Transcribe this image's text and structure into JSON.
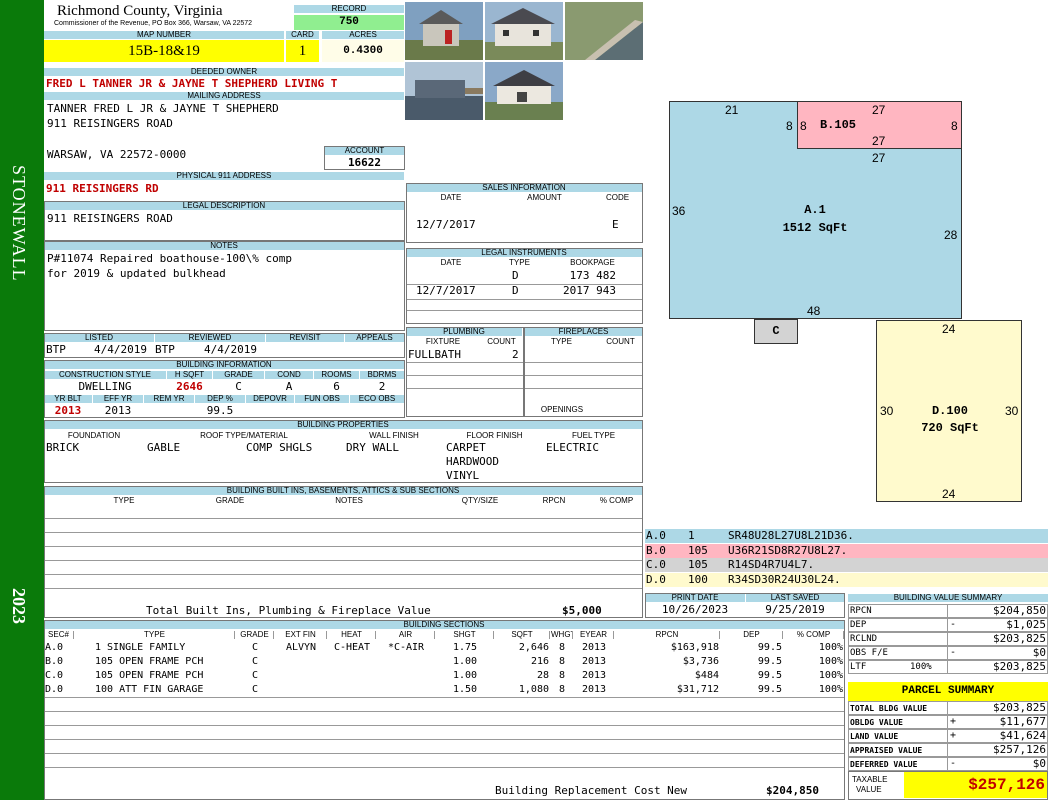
{
  "district": "STONEWALL",
  "year": "2023",
  "header": {
    "county": "Richmond County, Virginia",
    "commissioner": "Commissioner of the Revenue, PO Box 366, Warsaw, VA 22572",
    "record_label": "RECORD",
    "record": "750",
    "map_label": "MAP NUMBER",
    "map_number": "15B-18&19",
    "card_label": "CARD",
    "card": "1",
    "acres_label": "ACRES",
    "acres": "0.4300"
  },
  "owner": {
    "label": "DEEDED OWNER",
    "name": "FRED L TANNER JR & JAYNE T SHEPHERD LIVING T",
    "mail_label": "MAILING ADDRESS",
    "mail1": "TANNER FRED L JR & JAYNE T SHEPHERD",
    "mail2": "911 REISINGERS ROAD",
    "mail3": "WARSAW, VA 22572-0000",
    "account_label": "ACCOUNT",
    "account": "16622"
  },
  "phys": {
    "label": "PHYSICAL 911 ADDRESS",
    "value": "911 REISINGERS RD"
  },
  "legal": {
    "label": "LEGAL DESCRIPTION",
    "value": "911 REISINGERS ROAD"
  },
  "notes": {
    "label": "NOTES",
    "line1": "P#11074 Repaired boathouse-100\\% comp",
    "line2": "for 2019 & updated bulkhead"
  },
  "listing": {
    "listed_label": "LISTED",
    "reviewed_label": "REVIEWED",
    "revisit_label": "REVISIT",
    "appeals_label": "APPEALS",
    "listed_by": "BTP",
    "listed_date": "4/4/2019",
    "reviewed_by": "BTP",
    "reviewed_date": "4/4/2019"
  },
  "building_info": {
    "label": "BUILDING INFORMATION",
    "h_cs": "CONSTRUCTION STYLE",
    "h_hsqft": "H SQFT",
    "h_grade": "GRADE",
    "h_cond": "COND",
    "h_rooms": "ROOMS",
    "h_bdrms": "BDRMS",
    "style": "DWELLING",
    "hsqft": "2646",
    "grade": "C",
    "cond": "A",
    "rooms": "6",
    "bdrms": "2",
    "h_yrblt": "YR BLT",
    "h_effyr": "EFF YR",
    "h_remyr": "REM YR",
    "h_dep": "DEP %",
    "h_depovr": "DEPOVR",
    "h_funobs": "FUN OBS",
    "h_ecoobs": "ECO OBS",
    "yrblt": "2013",
    "effyr": "2013",
    "dep": "99.5"
  },
  "sales": {
    "label": "SALES INFORMATION",
    "h_date": "DATE",
    "h_amount": "AMOUNT",
    "h_code": "CODE",
    "date": "12/7/2017",
    "code": "E"
  },
  "instruments": {
    "label": "LEGAL INSTRUMENTS",
    "h_date": "DATE",
    "h_type": "TYPE",
    "h_bookpage": "BOOKPAGE",
    "rows": [
      {
        "date": "",
        "type": "D",
        "bookpage": "173 482"
      },
      {
        "date": "12/7/2017",
        "type": "D",
        "bookpage": "2017 943"
      }
    ]
  },
  "plumbing": {
    "label": "PLUMBING",
    "h_fixture": "FIXTURE",
    "h_count": "COUNT",
    "fixture": "FULLBATH",
    "count": "2"
  },
  "fireplaces": {
    "label": "FIREPLACES",
    "h_type": "TYPE",
    "h_count": "COUNT",
    "openings": "OPENINGS"
  },
  "props": {
    "label": "BUILDING PROPERTIES",
    "h_foundation": "FOUNDATION",
    "h_roof": "ROOF TYPE/MATERIAL",
    "h_wall": "WALL FINISH",
    "h_floor": "FLOOR FINISH",
    "h_fuel": "FUEL TYPE",
    "foundation": "BRICK",
    "roof_type": "GABLE",
    "roof_mat": "COMP SHGLS",
    "wall": "DRY WALL",
    "floor1": "CARPET",
    "floor2": "HARDWOOD",
    "floor3": "VINYL",
    "fuel": "ELECTRIC"
  },
  "builtins": {
    "label": "BUILDING BUILT INS, BASEMENTS, ATTICS & SUB SECTIONS",
    "h_type": "TYPE",
    "h_grade": "GRADE",
    "h_notes": "NOTES",
    "h_qty": "QTY/SIZE",
    "h_rpcn": "RPCN",
    "h_comp": "% COMP",
    "total_label": "Total Built Ins, Plumbing & Fireplace Value",
    "total": "$5,000"
  },
  "print": {
    "print_label": "PRINT DATE",
    "saved_label": "LAST SAVED",
    "print_date": "10/26/2023",
    "last_saved": "9/25/2019"
  },
  "sections": {
    "label": "BUILDING SECTIONS",
    "headers": [
      "SEC#",
      "TYPE",
      "GRADE",
      "EXT FIN",
      "HEAT",
      "AIR",
      "SHGT",
      "SQFT",
      "WHGT",
      "EYEAR",
      "RPCN",
      "DEP",
      "% COMP"
    ],
    "rows": [
      {
        "sec": "A.0",
        "type": "1 SINGLE FAMILY",
        "grade": "C",
        "ext": "ALVYN",
        "heat": "C-HEAT",
        "air": "*C-AIR",
        "shgt": "1.75",
        "sqft": "2,646",
        "whgt": "8",
        "eyear": "2013",
        "rpcn": "$163,918",
        "dep": "99.5",
        "comp": "100%"
      },
      {
        "sec": "B.0",
        "type": "105 OPEN FRAME PCH",
        "grade": "C",
        "ext": "",
        "heat": "",
        "air": "",
        "shgt": "1.00",
        "sqft": "216",
        "whgt": "8",
        "eyear": "2013",
        "rpcn": "$3,736",
        "dep": "99.5",
        "comp": "100%"
      },
      {
        "sec": "C.0",
        "type": "105 OPEN FRAME PCH",
        "grade": "C",
        "ext": "",
        "heat": "",
        "air": "",
        "shgt": "1.00",
        "sqft": "28",
        "whgt": "8",
        "eyear": "2013",
        "rpcn": "$484",
        "dep": "99.5",
        "comp": "100%"
      },
      {
        "sec": "D.0",
        "type": "100 ATT FIN GARAGE",
        "grade": "C",
        "ext": "",
        "heat": "",
        "air": "",
        "shgt": "1.50",
        "sqft": "1,080",
        "whgt": "8",
        "eyear": "2013",
        "rpcn": "$31,712",
        "dep": "99.5",
        "comp": "100%"
      }
    ],
    "replacement_label": "Building Replacement Cost New",
    "replacement": "$204,850"
  },
  "sketch": {
    "a_label": "A.1",
    "a_area": "1512 SqFt",
    "b_label": "B.105",
    "c_label": "C",
    "d_label": "D.100",
    "d_area": "720 SqFt",
    "dims": {
      "a_top": "21",
      "a_left": "36",
      "a_right": "28",
      "a_bottom": "48",
      "b_top": "27",
      "b_left": "8",
      "b_right": "8",
      "b_bottom": "27",
      "b_under": "27",
      "a_side8": "8",
      "d_top": "24",
      "d_left": "30",
      "d_right": "30",
      "d_bottom": "24"
    },
    "legend": [
      {
        "code": "A.0",
        "num": "1",
        "vec": "SR48U28L27U8L21D36.",
        "color": "#add8e6"
      },
      {
        "code": "B.0",
        "num": "105",
        "vec": "U36R21SD8R27U8L27.",
        "color": "#ffb6c1"
      },
      {
        "code": "C.0",
        "num": "105",
        "vec": "R14SD4R7U4L7.",
        "color": "#d3d3d3"
      },
      {
        "code": "D.0",
        "num": "100",
        "vec": "R34SD30R24U30L24.",
        "color": "#fffacd"
      }
    ]
  },
  "value_summary": {
    "label": "BUILDING VALUE SUMMARY",
    "rows": [
      {
        "k": "RPCN",
        "pct": "",
        "sign": "",
        "v": "$204,850"
      },
      {
        "k": "DEP",
        "pct": "",
        "sign": "-",
        "v": "$1,025"
      },
      {
        "k": "RCLND",
        "pct": "",
        "sign": "",
        "v": "$203,825"
      },
      {
        "k": "OBS F/E",
        "pct": "",
        "sign": "-",
        "v": "$0"
      },
      {
        "k": "LTF",
        "pct": "100%",
        "sign": "",
        "v": "$203,825"
      }
    ]
  },
  "parcel": {
    "label": "PARCEL SUMMARY",
    "rows": [
      {
        "k": "TOTAL BLDG VALUE",
        "sign": "",
        "v": "$203,825"
      },
      {
        "k": "OBLDG VALUE",
        "sign": "+",
        "v": "$11,677"
      },
      {
        "k": "LAND VALUE",
        "sign": "+",
        "v": "$41,624"
      },
      {
        "k": "APPRAISED VALUE",
        "sign": "",
        "v": "$257,126"
      },
      {
        "k": "DEFERRED VALUE",
        "sign": "-",
        "v": "$0"
      }
    ],
    "taxable_label1": "TAXABLE",
    "taxable_label2": "VALUE",
    "taxable": "$257,126"
  }
}
